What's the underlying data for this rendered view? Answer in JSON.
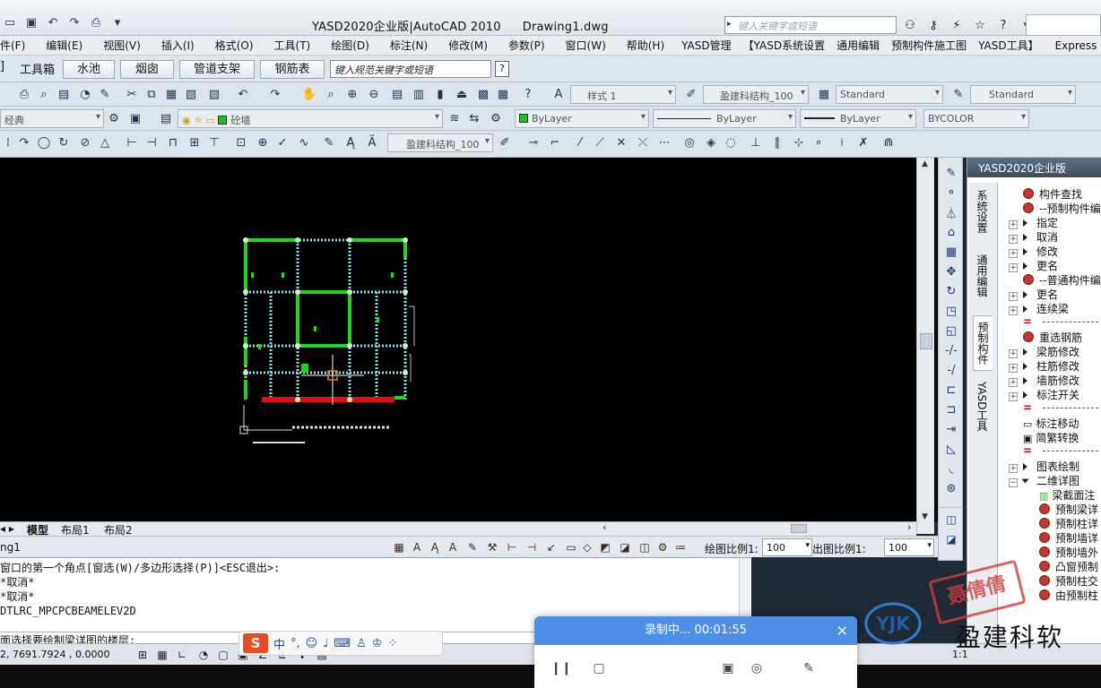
{
  "window": {
    "title": "YASD2020企业版|AutoCAD 2010",
    "document": "Drawing1.dwg",
    "search_placeholder": "键入关键字或短语"
  },
  "menubar": {
    "items": [
      "件(F)",
      "编辑(E)",
      "视图(V)",
      "插入(I)",
      "格式(O)",
      "工具(T)",
      "绘图(D)",
      "标注(N)",
      "修改(M)",
      "参数(P)",
      "窗口(W)",
      "帮助(H)",
      "YASD管理",
      "【YASD系统设置",
      "通用编辑",
      "预制构件施工图",
      "YASD工具】",
      "Express"
    ]
  },
  "tabbar": {
    "label_left": "]",
    "toolbox": "工具箱",
    "buttons": [
      "水池",
      "烟囱",
      "管道支架",
      "钢筋表"
    ],
    "spec_search": "键入规范关键字或短语",
    "help_q": "?"
  },
  "styles_row": {
    "text_style": "样式 1",
    "dim_style": "盈建科结构_100",
    "table_style": "Standard",
    "multileader_style": "Standard"
  },
  "layers_row": {
    "workspace": "经典",
    "layer": "砼墙",
    "color": "ByLayer",
    "linetype": "ByLayer",
    "lineweight": "ByLayer",
    "plotstyle": "BYCOLOR"
  },
  "draw_row": {
    "dim_style": "盈建科结构_100"
  },
  "model_tabs": {
    "items": [
      "模型",
      "布局1",
      "布局2"
    ],
    "active": "模型"
  },
  "annotation_strip": {
    "drawing_name": "ng1",
    "draw_scale_label": "绘图比例1:",
    "draw_scale_value": "100",
    "out_scale_label": "出图比例1:",
    "out_scale_value": "100"
  },
  "command": {
    "lines": [
      "窗口的第一个角点[窗选(W)/多边形选择(P)]<ESC退出>:",
      "*取消*",
      "*取消*",
      "DTLRC_MPCPCBEAMELEV2D"
    ],
    "prompt": "面选择要绘制梁详图的楼层:"
  },
  "statusbar": {
    "coords": "2, 7691.7924 , 0.0000",
    "scale": "1:1"
  },
  "ime": {
    "logo": "S",
    "mode": "中"
  },
  "palette": {
    "title": "YASD2020企业版",
    "side_tabs": [
      "系统设置",
      "通用编辑",
      "预制构件",
      "YASD工具"
    ],
    "active_tab": "预制构件",
    "tree": [
      {
        "type": "red",
        "text": "构件查找"
      },
      {
        "type": "red",
        "text": "--预制构件编"
      },
      {
        "type": "exp",
        "text": "指定"
      },
      {
        "type": "exp",
        "text": "取消"
      },
      {
        "type": "exp",
        "text": "修改"
      },
      {
        "type": "exp",
        "text": "更名"
      },
      {
        "type": "red",
        "text": "--普通构件编"
      },
      {
        "type": "exp",
        "text": "更名"
      },
      {
        "type": "exp",
        "text": "连续梁"
      },
      {
        "type": "sep",
        "text": "="
      },
      {
        "type": "red",
        "text": "重选钢筋"
      },
      {
        "type": "exp",
        "text": "梁筋修改"
      },
      {
        "type": "exp",
        "text": "柱筋修改"
      },
      {
        "type": "exp",
        "text": "墙筋修改"
      },
      {
        "type": "exp",
        "text": "标注开关"
      },
      {
        "type": "sep",
        "text": "="
      },
      {
        "type": "plain",
        "text": "标注移动"
      },
      {
        "type": "plain",
        "text": "简繁转换"
      },
      {
        "type": "sep",
        "text": "="
      },
      {
        "type": "exp",
        "text": "图表绘制"
      },
      {
        "type": "open",
        "text": "二维详图"
      },
      {
        "type": "sub",
        "text": "梁截面注"
      },
      {
        "type": "subred",
        "text": "预制梁详"
      },
      {
        "type": "subred",
        "text": "预制柱详"
      },
      {
        "type": "subred",
        "text": "预制墙详"
      },
      {
        "type": "subred",
        "text": "预制墙外"
      },
      {
        "type": "subred",
        "text": "凸窗预制"
      },
      {
        "type": "subred",
        "text": "预制柱交"
      },
      {
        "type": "subred",
        "text": "由预制柱"
      }
    ]
  },
  "branding": {
    "stamp": "聂倩倩",
    "logo": "YJK",
    "company": "盈建科软"
  },
  "recorder": {
    "status": "录制中... 00:01:55"
  },
  "colors": {
    "canvas": "#000000",
    "beam_green": "#1fd61f",
    "beam_red": "#e01010",
    "grid_cyan": "#8fdde6",
    "palette_header": "#4a5a6e",
    "recorder_blue": "#4e8fe6"
  }
}
